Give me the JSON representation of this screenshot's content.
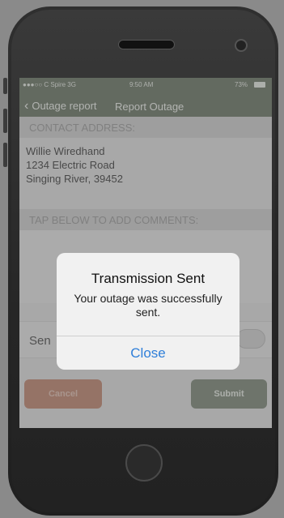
{
  "status_bar": {
    "carrier": "●●●○○ C Spire  3G",
    "time": "9:50 AM",
    "battery": "73%"
  },
  "nav": {
    "back_label": "Outage report",
    "title": "Report Outage"
  },
  "contact_section": {
    "header": "CONTACT ADDRESS:",
    "name": "Willie Wiredhand",
    "street": "1234 Electric Road",
    "city": "Singing River, 39452"
  },
  "comments_section": {
    "header": "TAP BELOW TO ADD COMMENTS:"
  },
  "send_row": {
    "label": "Sen"
  },
  "buttons": {
    "cancel": "Cancel",
    "submit": "Submit"
  },
  "alert": {
    "title": "Transmission Sent",
    "message": "Your outage was successfully sent.",
    "close": "Close"
  },
  "colors": {
    "nav_bar": "#5a6655",
    "cancel_button": "#b5775f",
    "submit_button": "#6e7969",
    "alert_link": "#2f7fd9"
  }
}
